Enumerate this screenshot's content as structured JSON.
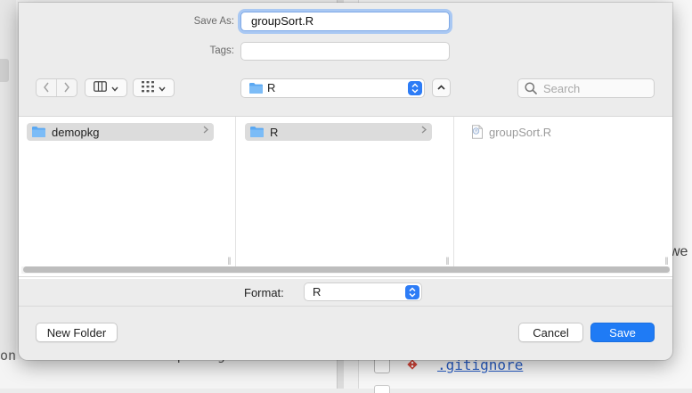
{
  "background": {
    "left_code_fragment": "on for Statistical Computing",
    "right_partial_text": "we",
    "git_file": ".gitignore"
  },
  "dialog": {
    "save_as_label": "Save As:",
    "save_as_value": "groupSort.R",
    "tags_label": "Tags:",
    "tags_value": "",
    "location": "R",
    "search_placeholder": "Search",
    "columns": [
      {
        "items": [
          {
            "name": "demopkg",
            "kind": "folder",
            "selected": true
          }
        ]
      },
      {
        "items": [
          {
            "name": "R",
            "kind": "folder",
            "selected": true
          }
        ]
      },
      {
        "items": [
          {
            "name": "groupSort.R",
            "kind": "file",
            "selected": false
          }
        ]
      }
    ],
    "format_label": "Format:",
    "format_value": "R",
    "new_folder_label": "New Folder",
    "cancel_label": "Cancel",
    "save_label": "Save"
  },
  "colors": {
    "accent": "#1f7bf5",
    "folder": "#5aa8f2",
    "focus_ring": "#a9c8f3"
  }
}
